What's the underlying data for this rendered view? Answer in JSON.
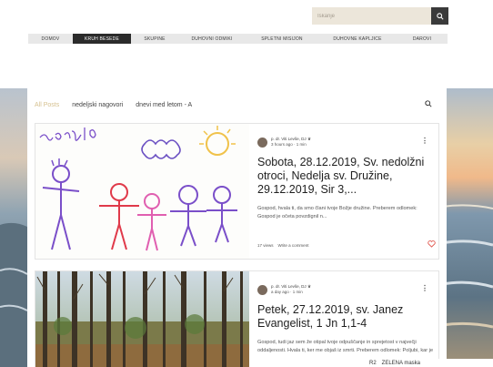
{
  "search": {
    "placeholder": "Iskanje"
  },
  "topnav": {
    "items": [
      {
        "label": "DOMOV",
        "active": false
      },
      {
        "label": "KRUH BESEDE",
        "active": true
      },
      {
        "label": "SKUPINE",
        "active": false
      },
      {
        "label": "DUHOVNI ODMIKI",
        "active": false
      },
      {
        "label": "SPLETNI MISIJON",
        "active": false
      },
      {
        "label": "DUHOVNE KAPLJICE",
        "active": false
      },
      {
        "label": "DAROVI",
        "active": false
      }
    ]
  },
  "blog": {
    "categories": [
      {
        "label": "All Posts",
        "active": true
      },
      {
        "label": "nedeljski nagovori",
        "active": false
      },
      {
        "label": "dnevi med letom - A",
        "active": false
      }
    ],
    "posts": [
      {
        "author": "p. dr. Viti Levše, DJ",
        "time": "3 hours ago · 1 min",
        "title": "Sobota, 28.12.2019, Sv. nedolžni otroci, Nedelja sv. Družine, 29.12.2019, Sir 3,...",
        "excerpt": "Gospod, hvala ti, da smo člani tvoje Božje družine. Preberem odlomek: Gospod je očeta povzdignil n...",
        "views": "17 views",
        "comment": "Write a comment"
      },
      {
        "author": "p. dr. Viti Levše, DJ",
        "time": "a day ago · 1 min",
        "title": "Petek, 27.12.2019, sv. Janez Evangelist, 1 Jn 1,1-4",
        "excerpt": "Gospod, tudi jaz sem že otipal tvoje odpuščanje in sprejetost v največji oddaljenosti. Hvala ti, ker me objaš iz smrti. Preberem odlomek: Poljubi, kar je"
      }
    ]
  },
  "ticker": {
    "left": "R2",
    "right": "ZELENA maska"
  },
  "colors": {
    "accent": "#d6c18f",
    "nav_active": "#2b2b2b",
    "heart": "#e0534a"
  }
}
